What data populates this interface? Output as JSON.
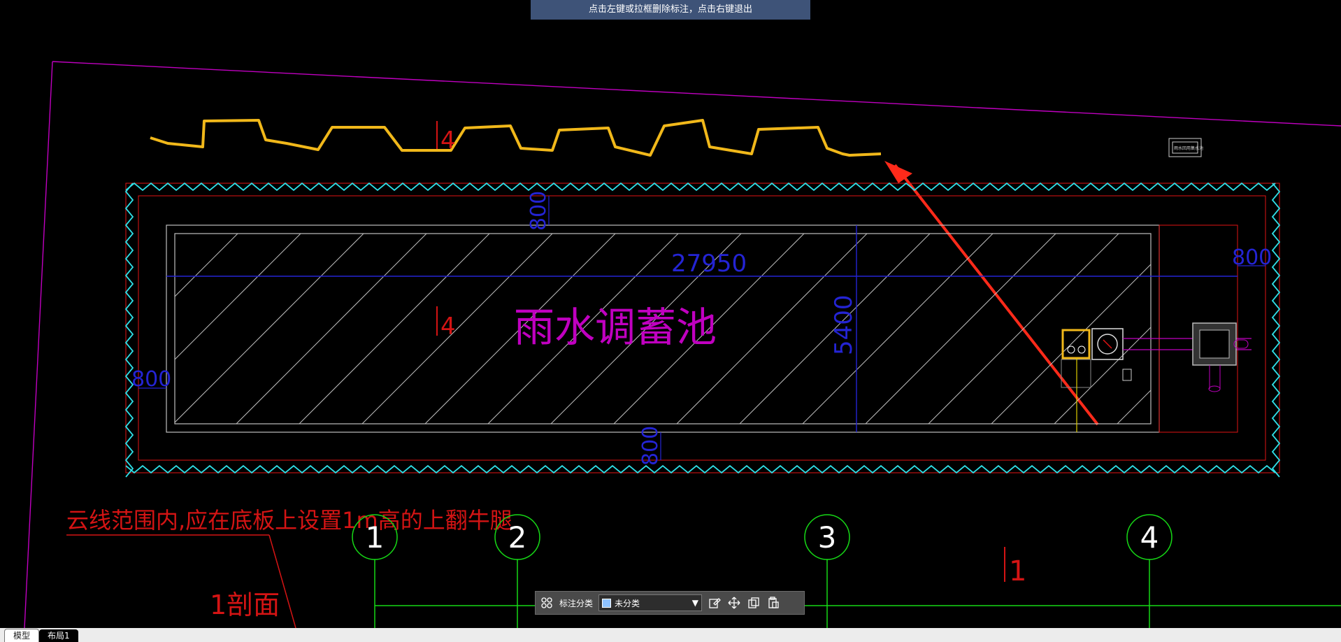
{
  "banner": {
    "text": "点击左键或拉框删除标注，点击右键退出"
  },
  "drawing": {
    "title": "雨水调蓄池",
    "dims": {
      "length": "27950",
      "width": "5400",
      "top": "800",
      "bottom": "800",
      "left": "800",
      "right": "800"
    },
    "note": "云线范围内,应在底板上设置1m高的上翻牛腿",
    "section_label": "1剖面",
    "grid_markers": [
      "1",
      "2",
      "3",
      "4"
    ],
    "marks": {
      "cut_a": "4",
      "cut_b": "4",
      "cut_c": "1"
    },
    "small_box_text": "雨水回用集水池",
    "colors": {
      "cloud": "#f1b81a",
      "arrow": "#ff2a1a",
      "magenta": "#c000c0",
      "cyan": "#2fe0e8",
      "grid": "#16d916"
    }
  },
  "toolbar": {
    "category_label": "标注分类",
    "category_value": "未分类",
    "icons": [
      "grid-icon",
      "edit-icon",
      "move-icon",
      "copy-icon",
      "paste-icon"
    ]
  },
  "tabs": [
    {
      "label": "模型",
      "active": false
    },
    {
      "label": "布局1",
      "active": true
    }
  ]
}
